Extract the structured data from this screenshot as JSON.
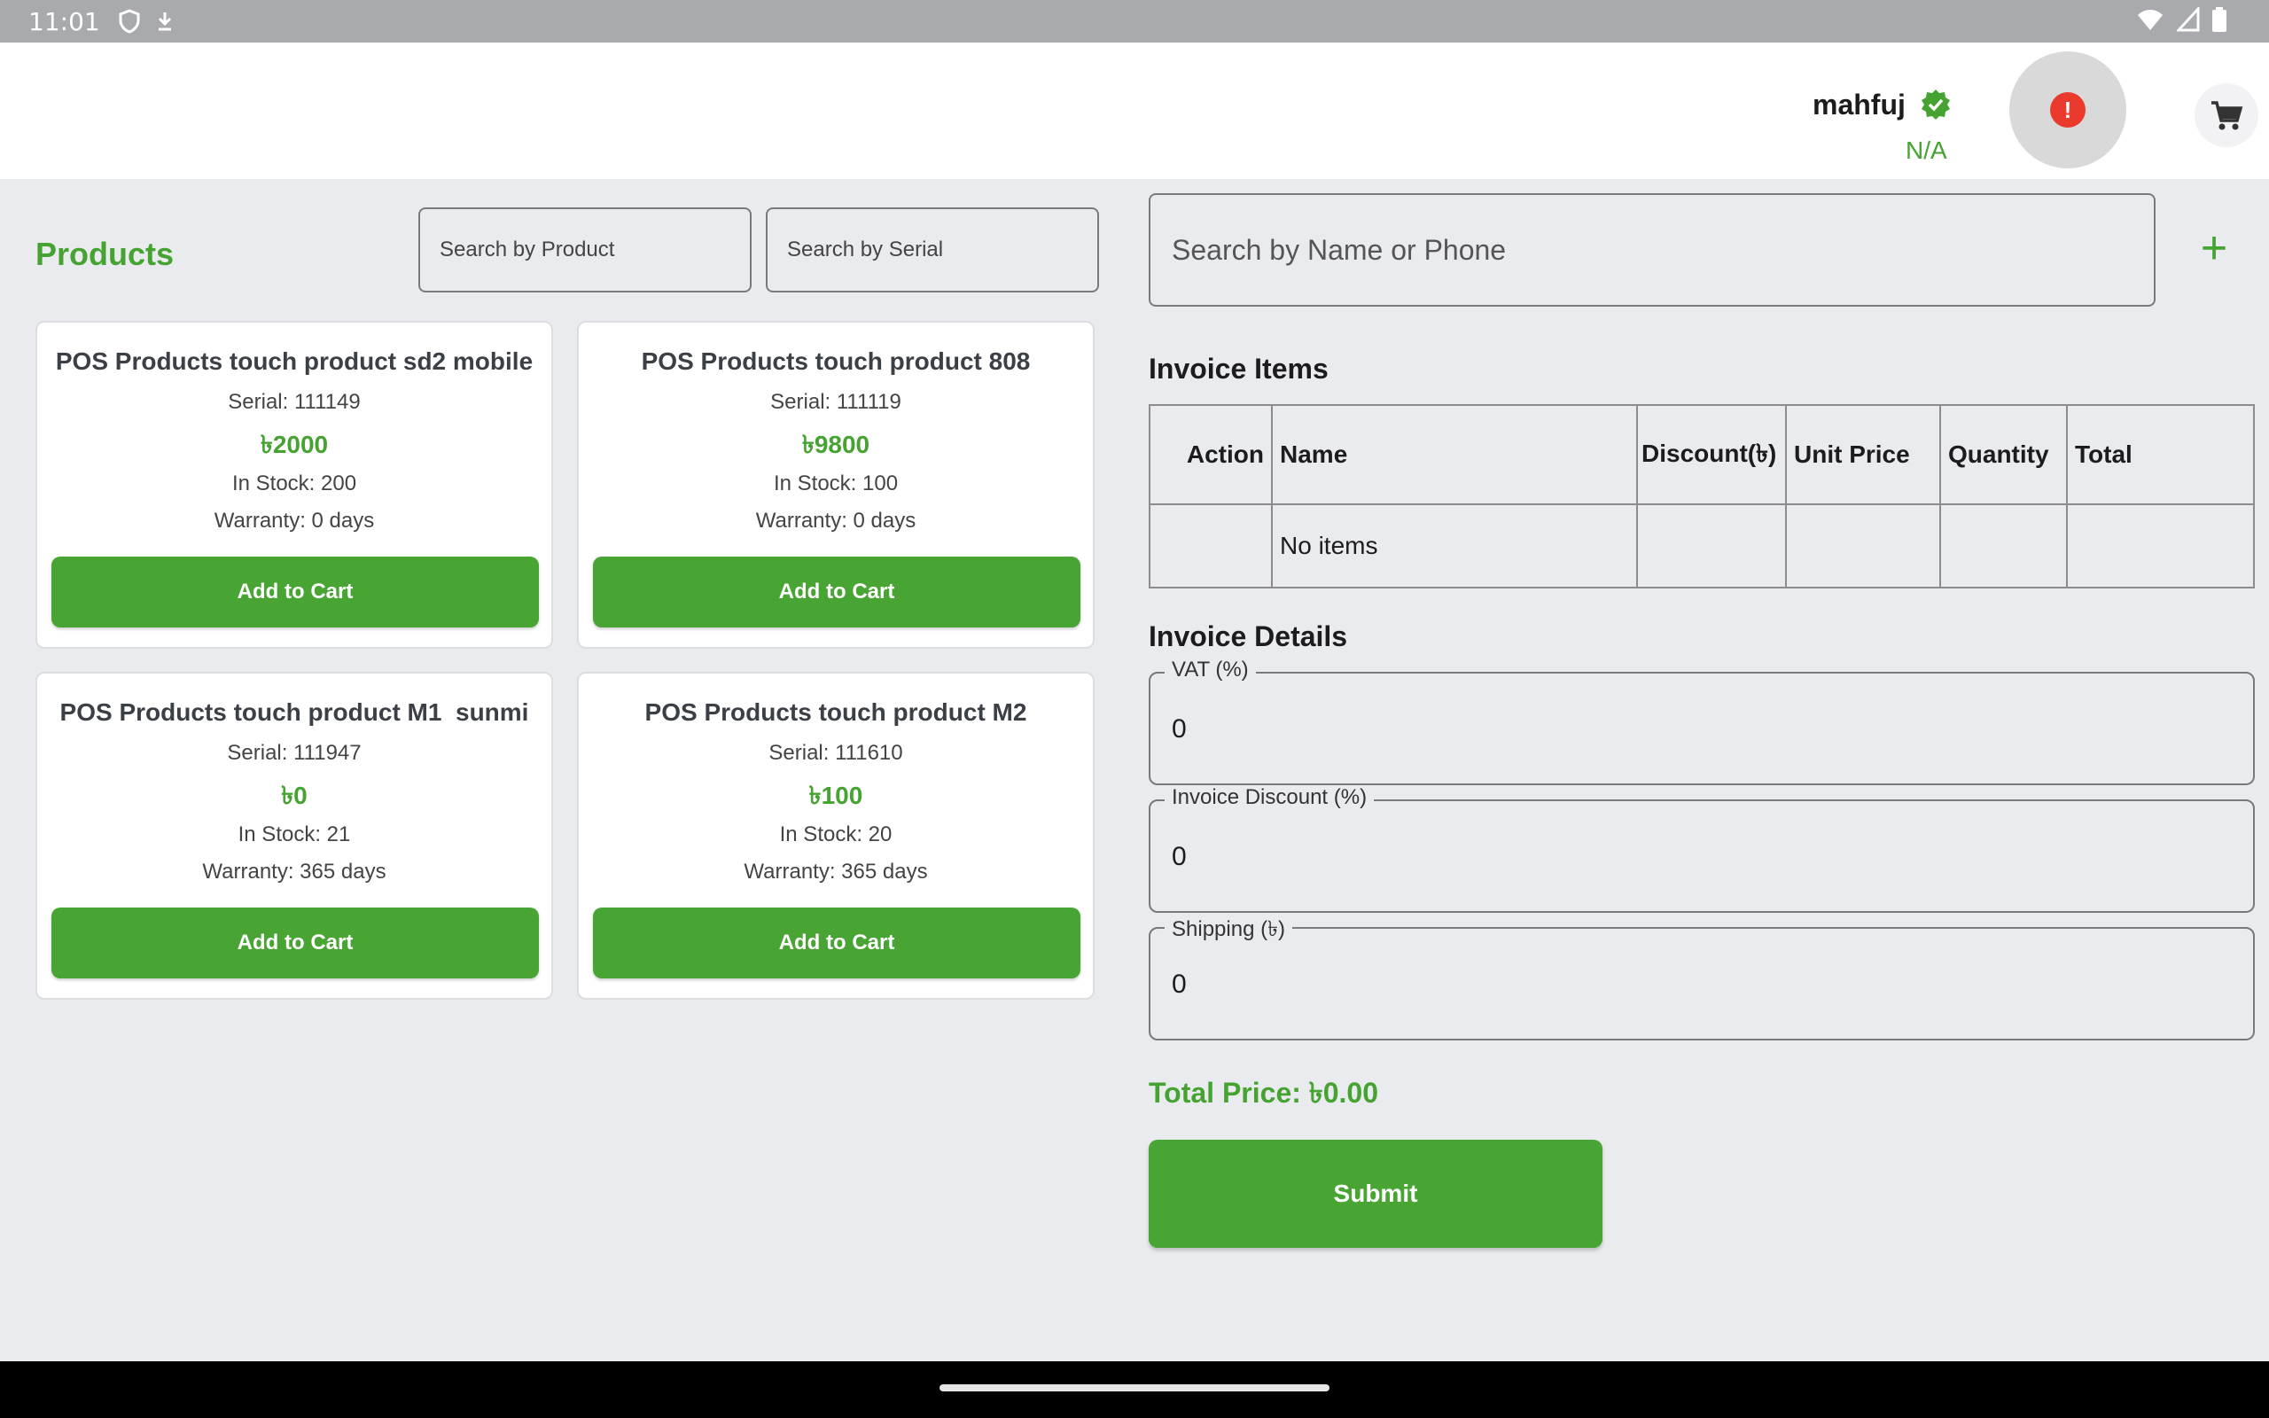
{
  "status_bar": {
    "time": "11:01",
    "icons": [
      "shield-icon",
      "download-icon",
      "wifi-icon",
      "signal-icon",
      "battery-icon"
    ]
  },
  "header": {
    "username": "mahfuj",
    "status": "N/A",
    "alert_icon": "!",
    "icons": [
      "verified-icon",
      "alert-icon",
      "cart-icon"
    ]
  },
  "products": {
    "title": "Products",
    "search_product_placeholder": "Search by Product",
    "search_serial_placeholder": "Search by Serial",
    "items": [
      {
        "name": "POS Products touch product sd2 mobile",
        "serial": "Serial: 111149",
        "price": "৳2000",
        "stock": "In Stock: 200",
        "warranty": "Warranty: 0 days",
        "button": "Add to Cart"
      },
      {
        "name": "POS Products touch product 808",
        "serial": "Serial: 111119",
        "price": "৳9800",
        "stock": "In Stock: 100",
        "warranty": "Warranty: 0 days",
        "button": "Add to Cart"
      },
      {
        "name": "POS Products touch product M1  sunmi",
        "serial": "Serial: 111947",
        "price": "৳0",
        "stock": "In Stock: 21",
        "warranty": "Warranty: 365 days",
        "button": "Add to Cart"
      },
      {
        "name": "POS Products touch product M2",
        "serial": "Serial: 111610",
        "price": "৳100",
        "stock": "In Stock: 20",
        "warranty": "Warranty: 365 days",
        "button": "Add to Cart"
      }
    ]
  },
  "customer": {
    "search_placeholder": "Search by Name or Phone",
    "add_icon": "+"
  },
  "invoice_items": {
    "title": "Invoice Items",
    "columns": [
      "Action",
      "Name",
      "Discount(৳)",
      "Unit Price",
      "Quantity",
      "Total"
    ],
    "empty_text": "No items"
  },
  "invoice_details": {
    "title": "Invoice Details",
    "vat_label": "VAT (%)",
    "vat_value": "0",
    "discount_label": "Invoice Discount (%)",
    "discount_value": "0",
    "shipping_label": "Shipping (৳)",
    "shipping_value": "0"
  },
  "total_price": "Total Price: ৳0.00",
  "submit_label": "Submit",
  "colors": {
    "accent": "#48a533",
    "background": "#eaebef",
    "alert": "#ea3a2e"
  }
}
